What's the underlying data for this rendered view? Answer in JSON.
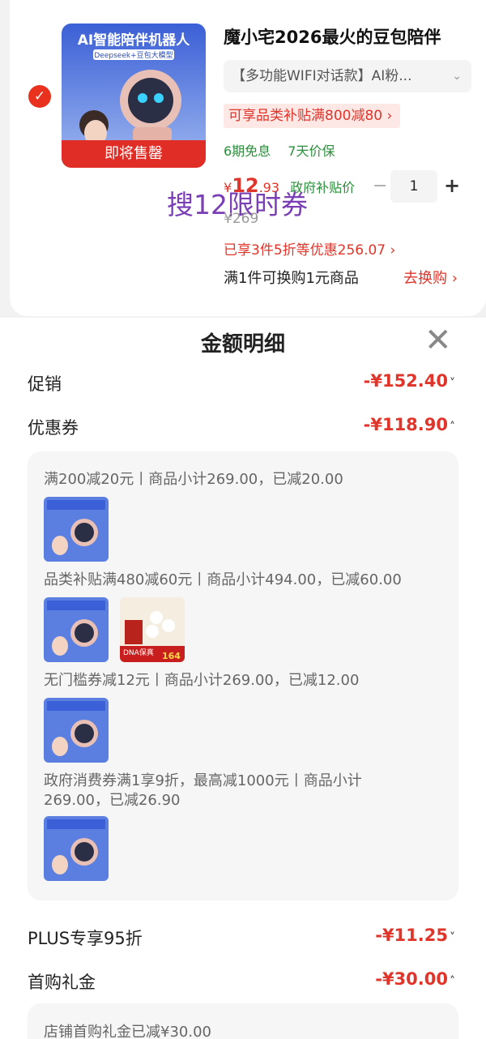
{
  "product": {
    "image_title": "AI智能陪伴机器人",
    "image_sub": "Deepseek+豆包大模型",
    "soon_label": "即将售罄",
    "title": "魔小宅2026最火的豆包陪伴",
    "spec": "【多功能WIFI对话款】AI粉...",
    "subsidy_tag": "可享品类补贴满800减80 ›",
    "free_installments": "6期免息",
    "price_protect": "7天价保",
    "price_prefix": "¥",
    "price_int": "12",
    "price_dec": ".93",
    "gov_price_label": "政府补贴价",
    "quantity": "1",
    "orig_price": "¥269",
    "discount_line": "已享3件5折等优惠256.07 ›",
    "swap_text": "满1件可换购1元商品",
    "swap_link": "去换购 ›",
    "overlay_promo": "搜12限时券",
    "colors": {
      "accent": "#e0352a",
      "green": "#2a8f3a",
      "promo": "#7b3fb5"
    }
  },
  "sheet": {
    "title": "金额明细",
    "close_icon": "close-icon",
    "rows": {
      "promotion": {
        "label": "促销",
        "amount": "-¥152.40",
        "chevron": "˅"
      },
      "coupon": {
        "label": "优惠券",
        "amount": "-¥118.90",
        "chevron": "˄"
      },
      "plus": {
        "label": "PLUS专享95折",
        "amount": "-¥11.25",
        "chevron": "˅"
      },
      "first_gift": {
        "label": "首购礼金",
        "amount": "-¥30.00",
        "chevron": "˄"
      }
    },
    "coupons": [
      {
        "text": "满200减20元丨商品小计269.00，已减20.00"
      },
      {
        "text": "品类补贴满480减60元丨商品小计494.00，已减60.00"
      },
      {
        "text": "无门槛券减12元丨商品小计269.00，已减12.00"
      },
      {
        "text_line1": "政府消费券满1享9折，最高减1000元丨商品小计",
        "text_line2": "269.00，已减26.90"
      }
    ],
    "second_item_badge": "DNA保真",
    "second_item_price": "164",
    "gift_detail": "店铺首购礼金已减¥30.00"
  }
}
